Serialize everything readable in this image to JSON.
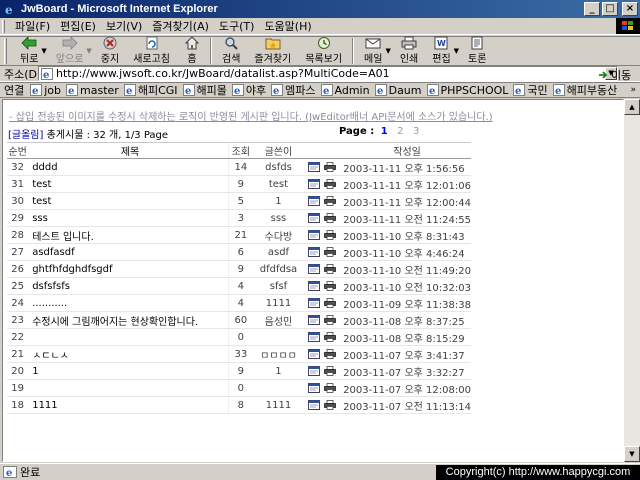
{
  "window": {
    "title": "JwBoard - Microsoft Internet Explorer",
    "min": "_",
    "max": "□",
    "close": "×"
  },
  "menu": [
    "파일(F)",
    "편집(E)",
    "보기(V)",
    "즐겨찾기(A)",
    "도구(T)",
    "도움말(H)"
  ],
  "toolbar": {
    "back": "뒤로",
    "forward": "앞으로",
    "stop": "중지",
    "refresh": "새로고침",
    "home": "홈",
    "search": "검색",
    "favorites": "즐겨찾기",
    "history": "목록보기",
    "mail": "메일",
    "print": "인쇄",
    "edit": "편집",
    "discuss": "토론"
  },
  "address": {
    "label": "주소(D)",
    "url": "http://www.jwsoft.co.kr/JwBoard/datalist.asp?MultiCode=A01",
    "go": "이동"
  },
  "links": {
    "label": "연결",
    "items": [
      "job",
      "master",
      "해피CGI",
      "해피몰",
      "야후",
      "엠파스",
      "Admin",
      "Daum",
      "PHPSCHOOL",
      "국민",
      "해피부동산"
    ],
    "more": "»"
  },
  "page": {
    "notice": "- 삽입 전송된 이미지를 수정시 삭제하는 로직이 반영된 게시판 입니다. (JwEditor배너 API문서에 소스가 있습니다.)",
    "board_tag": "[글올림]",
    "count_text": "총게시물 : 32 개, 1/3 Page",
    "page_label": "Page :",
    "pages": [
      "1",
      "2",
      "3"
    ]
  },
  "table": {
    "headers": {
      "num": "순번",
      "title": "제목",
      "hits": "조회",
      "author": "글쓴이",
      "date": "작성일"
    },
    "rows": [
      {
        "num": "32",
        "title": "dddd",
        "hits": "14",
        "author": "dsfds",
        "date": "2003-11-11 오후 1:56:56"
      },
      {
        "num": "31",
        "title": "test",
        "hits": "9",
        "author": "test",
        "date": "2003-11-11 오후 12:01:06"
      },
      {
        "num": "30",
        "title": "test",
        "hits": "5",
        "author": "1",
        "date": "2003-11-11 오후 12:00:44"
      },
      {
        "num": "29",
        "title": "sss",
        "hits": "3",
        "author": "sss",
        "date": "2003-11-11 오전 11:24:55"
      },
      {
        "num": "28",
        "title": "테스트 입니다.",
        "hits": "21",
        "author": "수다방",
        "date": "2003-11-10 오후 8:31:43"
      },
      {
        "num": "27",
        "title": "asdfasdf",
        "hits": "6",
        "author": "asdf",
        "date": "2003-11-10 오후 4:46:24"
      },
      {
        "num": "26",
        "title": "ghtfhfdghdfsgdf",
        "hits": "9",
        "author": "dfdfdsa",
        "date": "2003-11-10 오전 11:49:20"
      },
      {
        "num": "25",
        "title": "dsfsfsfs",
        "hits": "4",
        "author": "sfsf",
        "date": "2003-11-10 오전 10:32:03"
      },
      {
        "num": "24",
        "title": "...........",
        "hits": "4",
        "author": "1111",
        "date": "2003-11-09 오후 11:38:38"
      },
      {
        "num": "23",
        "title": "수정시에 그림깨어지는 현상확인합니다.",
        "hits": "60",
        "author": "음성민",
        "date": "2003-11-08 오후 8:37:25"
      },
      {
        "num": "22",
        "title": "",
        "hits": "0",
        "author": "",
        "date": "2003-11-08 오후 8:15:29"
      },
      {
        "num": "21",
        "title": "ㅅㄷㄴㅅ",
        "hits": "33",
        "author": "ㅁㅁㅁㅁ",
        "date": "2003-11-07 오후 3:41:37"
      },
      {
        "num": "20",
        "title": "1",
        "hits": "9",
        "author": "1",
        "date": "2003-11-07 오후 3:32:27"
      },
      {
        "num": "19",
        "title": "",
        "hits": "0",
        "author": "",
        "date": "2003-11-07 오후 12:08:00"
      },
      {
        "num": "18",
        "title": "1111",
        "hits": "8",
        "author": "1111",
        "date": "2003-11-07 오전 11:13:14"
      }
    ]
  },
  "status": {
    "text": "완료",
    "copyright": "Copyright(c) http://www.happycgi.com"
  }
}
